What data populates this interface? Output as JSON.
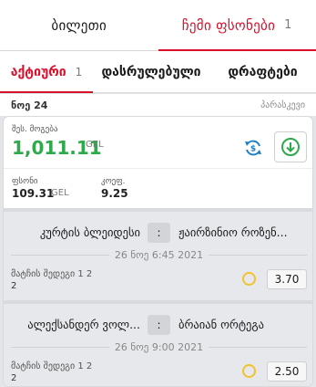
{
  "top_tabs": [
    {
      "label": "ბილეთი",
      "count": ""
    },
    {
      "label": "ჩემი ფსონები",
      "count": "1"
    }
  ],
  "sub_tabs": [
    {
      "label": "აქტიური",
      "count": "1"
    },
    {
      "label": "დასრულებული",
      "count": ""
    },
    {
      "label": "დრაფტები",
      "count": ""
    }
  ],
  "date_header": "ნოე 24",
  "bet_type": "პარასკევი",
  "bet": {
    "payout_label": "შეს. მოგება",
    "payout_amount": "1,011.11",
    "payout_currency": "GEL",
    "stake_label": "ფსონი",
    "stake_value": "109.31",
    "stake_currency": "GEL",
    "odds_label": "კოეფ.",
    "odds_value": "9.25"
  },
  "events": [
    {
      "home": "კურტის ბლეიდესი",
      "vs": ":",
      "away": "ჟაირზინიო როზენ...",
      "date": "26 ნოე 6:45 2021",
      "market": "მატჩის შედეგი 1 2",
      "selection": "2",
      "odds": "3.70"
    },
    {
      "home": "ალექსანდერ ვოლ...",
      "vs": ":",
      "away": "ბრაიან ორტეგა",
      "date": "26 ნოე 9:00 2021",
      "market": "მატჩის შედეგი 1 2",
      "selection": "2",
      "odds": "2.50"
    }
  ],
  "colors": {
    "accent": "#d8102c",
    "payout": "#2eaa4b",
    "pending": "#f2c12e",
    "refresh_icon": "#1f7fc4",
    "download_icon": "#2eaa4b"
  },
  "icons": {
    "refresh": "refresh-icon",
    "download": "download-icon",
    "status": "pending-status-icon"
  }
}
